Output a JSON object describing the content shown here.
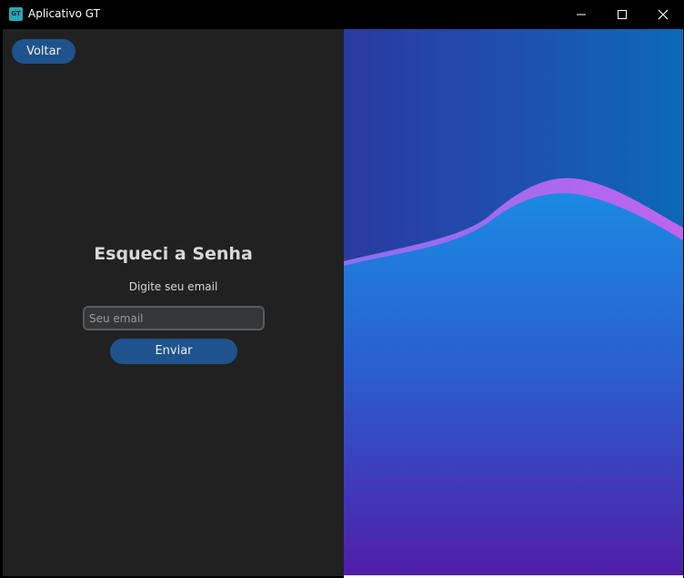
{
  "window": {
    "title": "Aplicativo GT",
    "icon_text": "GT"
  },
  "form": {
    "back_label": "Voltar",
    "title": "Esqueci a Senha",
    "subtitle": "Digite seu email",
    "email_placeholder": "Seu email",
    "email_value": "",
    "submit_label": "Enviar"
  },
  "colors": {
    "button_bg": "#1f538d",
    "panel_bg": "#212121",
    "input_bg": "#343638",
    "wave_top": "#2740a4",
    "wave_front": "#1b86e0",
    "wave_back": "#b56bf0",
    "bottom": "#4e1fae"
  },
  "icons": {
    "minimize": "minimize-icon",
    "maximize": "maximize-icon",
    "close": "close-icon"
  }
}
